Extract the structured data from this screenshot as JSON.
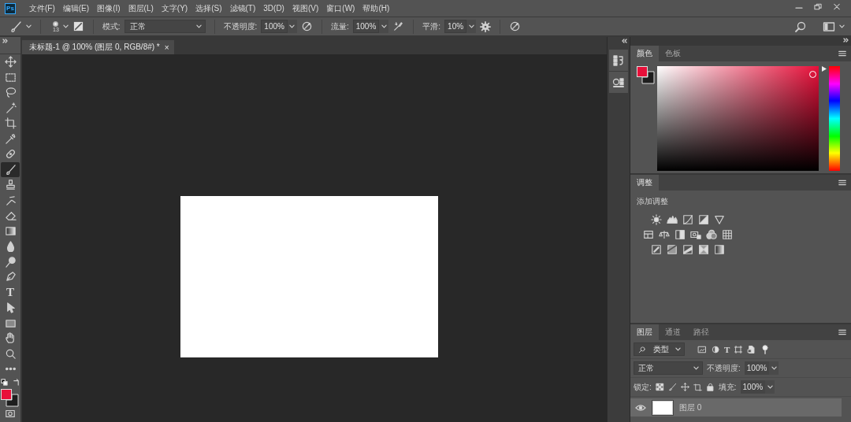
{
  "app_logo": "Ps",
  "menu": [
    "文件(F)",
    "编辑(E)",
    "图像(I)",
    "图层(L)",
    "文字(Y)",
    "选择(S)",
    "滤镜(T)",
    "3D(D)",
    "视图(V)",
    "窗口(W)",
    "帮助(H)"
  ],
  "options_bar": {
    "brush_size": "13",
    "mode_label": "模式:",
    "mode_value": "正常",
    "opacity_label": "不透明度:",
    "opacity_value": "100%",
    "flow_label": "流量:",
    "flow_value": "100%",
    "smoothing_label": "平滑:",
    "smoothing_value": "10%"
  },
  "document_tabs": [
    {
      "title": "未标题-1 @ 100% (图层 0, RGB/8#) *",
      "close": "×",
      "selected": true
    }
  ],
  "tools": [
    {
      "kind": "move",
      "selected": false
    },
    {
      "kind": "marquee",
      "selected": false
    },
    {
      "kind": "lasso",
      "selected": false
    },
    {
      "kind": "wand",
      "selected": false
    },
    {
      "kind": "crop",
      "selected": false
    },
    {
      "kind": "eyedropper",
      "selected": false
    },
    {
      "kind": "healing",
      "selected": false
    },
    {
      "kind": "brush",
      "selected": true
    },
    {
      "kind": "stamp",
      "selected": false
    },
    {
      "kind": "history",
      "selected": false
    },
    {
      "kind": "eraser",
      "selected": false
    },
    {
      "kind": "gradient",
      "selected": false
    },
    {
      "kind": "blur",
      "selected": false
    },
    {
      "kind": "dodge",
      "selected": false
    },
    {
      "kind": "pen",
      "selected": false
    },
    {
      "kind": "type",
      "glyph": "T",
      "selected": false
    },
    {
      "kind": "pathselect",
      "selected": false
    },
    {
      "kind": "shape",
      "selected": false
    },
    {
      "kind": "hand",
      "selected": false
    },
    {
      "kind": "zoom",
      "selected": false
    },
    {
      "kind": "more",
      "selected": false
    }
  ],
  "toolbar_swatches": [
    {
      "kind": "foreground",
      "color": "#e8103a"
    },
    {
      "kind": "background",
      "color": "#1e1e1e"
    }
  ],
  "color_panel": {
    "tabs": [
      {
        "label": "颜色",
        "selected": true
      },
      {
        "label": "色板",
        "selected": false
      }
    ],
    "swatches": [
      {
        "kind": "foreground",
        "color": "#e8103a"
      },
      {
        "kind": "background",
        "color": "#1e1e1e"
      }
    ]
  },
  "adjustments_panel": {
    "tabs": [
      {
        "label": "调整",
        "selected": true
      }
    ],
    "heading": "添加调整"
  },
  "layers_panel": {
    "tabs": [
      {
        "label": "图层",
        "selected": true
      },
      {
        "label": "通道",
        "selected": false
      },
      {
        "label": "路径",
        "selected": false
      }
    ],
    "filter": "类型",
    "type_filter_glyph": "T",
    "blend_mode": "正常",
    "opacity_label": "不透明度:",
    "opacity_value": "100%",
    "lock_label": "锁定:",
    "fill_label": "填充:",
    "fill_value": "100%",
    "layers": [
      {
        "name": "图层 0",
        "visible": true,
        "selected": true
      }
    ]
  }
}
